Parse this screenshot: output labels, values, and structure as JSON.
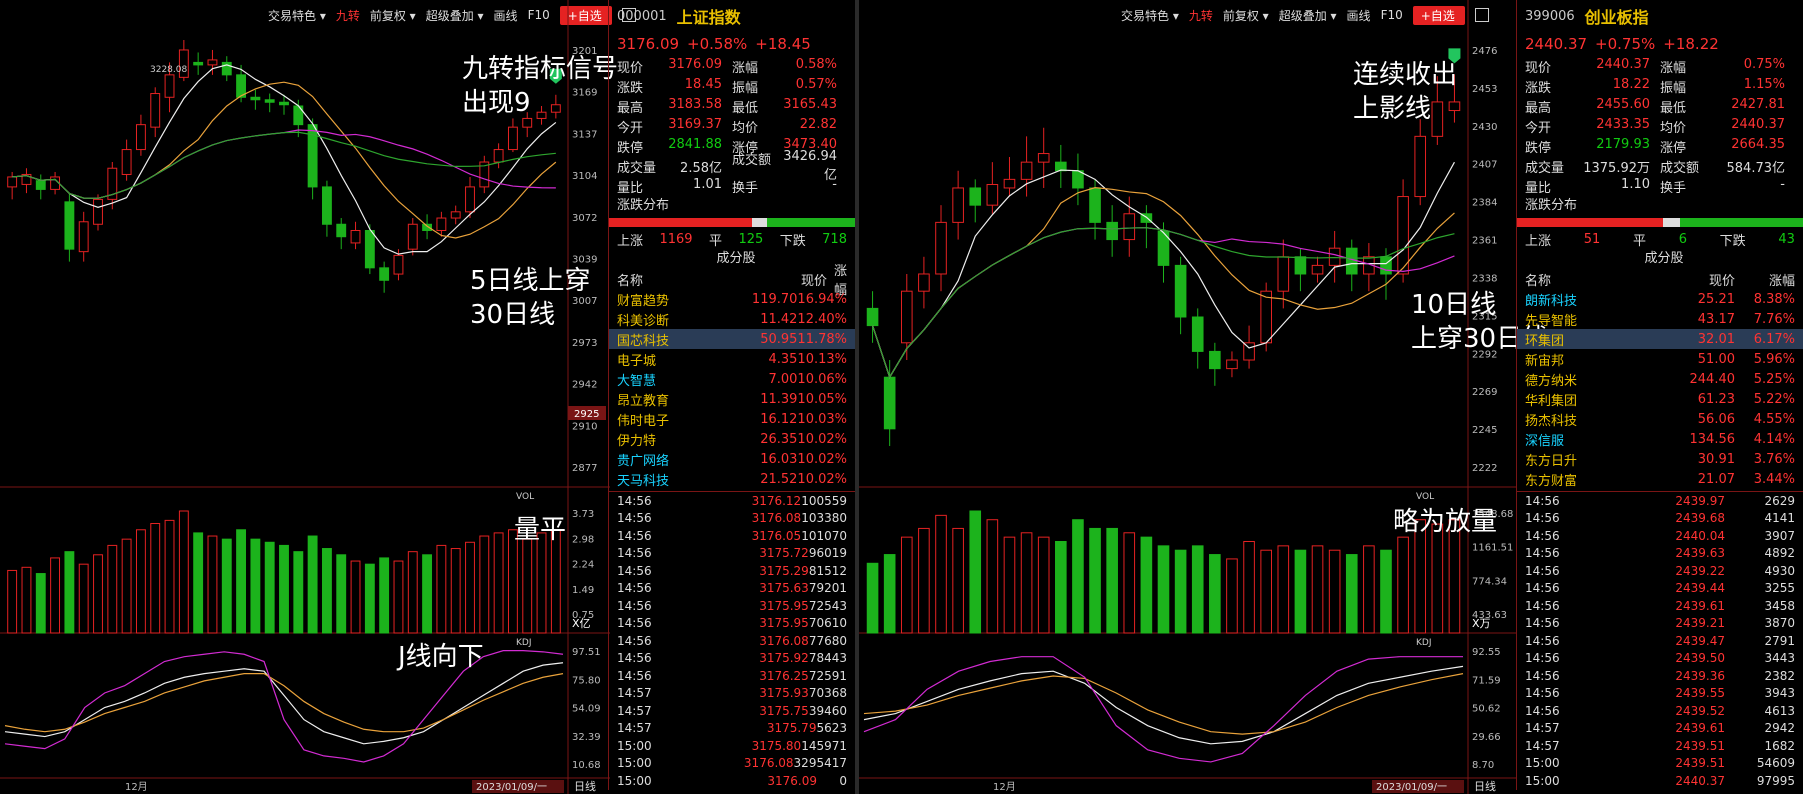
{
  "left": {
    "toolbar": [
      "交易特色 ▾",
      "九转",
      "前复权 ▾",
      "超级叠加 ▾",
      "画线",
      "F10",
      "+自选"
    ],
    "axis": [
      "3201",
      "3169",
      "3137",
      "3104",
      "3072",
      "3039",
      "3007",
      "2973",
      "2942",
      "2910",
      "2877"
    ],
    "price_tag": "2925",
    "high_label": "3228.08",
    "vol_label": "VOL",
    "vol_axis": [
      "3.73",
      "2.98",
      "2.24",
      "1.49",
      "0.75"
    ],
    "vol_unit": "X亿",
    "kdj_label": "KDJ",
    "kdj_axis": [
      "97.51",
      "75.80",
      "54.09",
      "32.39",
      "10.68"
    ],
    "month": "12月",
    "date": "2023/01/09/一",
    "period": "日线",
    "ann1": "九转指标信号\n出现9",
    "ann2": "5日线上穿\n30日线",
    "ann3": "量平",
    "ann4": "J线向下",
    "quote": {
      "code": "000001",
      "name": "上证指数",
      "price": "3176.09",
      "pct": "+0.58%",
      "chg": "+18.45",
      "rows": [
        [
          "现价",
          "3176.09",
          "涨幅",
          "0.58%"
        ],
        [
          "涨跌",
          "18.45",
          "振幅",
          "0.57%"
        ],
        [
          "最高",
          "3183.58",
          "最低",
          "3165.43"
        ],
        [
          "今开",
          "3169.37",
          "均价",
          "22.82"
        ],
        [
          "跌停",
          "2841.88",
          "涨停",
          "3473.40"
        ],
        [
          "成交量",
          "2.58亿",
          "成交额",
          "3426.94亿"
        ],
        [
          "量比",
          "1.01",
          "换手",
          "-"
        ]
      ],
      "dist_label": "涨跌分布",
      "up_label": "上涨",
      "up": "1169",
      "flat_label": "平",
      "flat": "125",
      "down_label": "下跌",
      "down": "718",
      "stock_title": "成分股",
      "stock_hdr": [
        "名称",
        "现价",
        "涨幅"
      ],
      "stocks": [
        [
          "财富趋势",
          "119.70",
          "16.94%"
        ],
        [
          "科美诊断",
          "11.42",
          "12.40%"
        ],
        [
          "国芯科技",
          "50.95",
          "11.78%"
        ],
        [
          "电子城",
          "4.35",
          "10.13%"
        ],
        [
          "大智慧",
          "7.00",
          "10.06%"
        ],
        [
          "昂立教育",
          "11.39",
          "10.05%"
        ],
        [
          "伟时电子",
          "16.12",
          "10.03%"
        ],
        [
          "伊力特",
          "26.35",
          "10.02%"
        ],
        [
          "贵广网络",
          "16.03",
          "10.02%"
        ],
        [
          "天马科技",
          "21.52",
          "10.02%"
        ]
      ],
      "ticks": [
        [
          "14:56",
          "3176.12",
          "100559"
        ],
        [
          "14:56",
          "3176.08",
          "103380"
        ],
        [
          "14:56",
          "3176.05",
          "101070"
        ],
        [
          "14:56",
          "3175.72",
          "96019"
        ],
        [
          "14:56",
          "3175.29",
          "81512"
        ],
        [
          "14:56",
          "3175.63",
          "79201"
        ],
        [
          "14:56",
          "3175.95",
          "72543"
        ],
        [
          "14:56",
          "3175.95",
          "70610"
        ],
        [
          "14:56",
          "3176.08",
          "77680"
        ],
        [
          "14:56",
          "3175.92",
          "78443"
        ],
        [
          "14:56",
          "3176.25",
          "72591"
        ],
        [
          "14:57",
          "3175.93",
          "70368"
        ],
        [
          "14:57",
          "3175.75",
          "39460"
        ],
        [
          "14:57",
          "3175.79",
          "5623"
        ],
        [
          "15:00",
          "3175.80",
          "145971"
        ],
        [
          "15:00",
          "3176.08",
          "3295417"
        ],
        [
          "15:00",
          "3176.09",
          "0"
        ]
      ]
    }
  },
  "right": {
    "toolbar": [
      "交易特色 ▾",
      "九转",
      "前复权 ▾",
      "超级叠加 ▾",
      "画线",
      "F10",
      "+自选"
    ],
    "axis": [
      "2476",
      "2453",
      "2430",
      "2407",
      "2384",
      "2361",
      "2338",
      "2315",
      "2292",
      "2269",
      "2245",
      "2222"
    ],
    "vol_axis": [
      "1548.68",
      "1161.51",
      "774.34",
      "433.63"
    ],
    "vol_unit": "X万",
    "vol_label": "VOL",
    "kdj_label": "KDJ",
    "kdj_axis": [
      "92.55",
      "71.59",
      "50.62",
      "29.66",
      "8.70"
    ],
    "month": "12月",
    "date": "2023/01/09/一",
    "period": "日线",
    "ann1": "连续收出\n上影线",
    "ann2": "10日线\n上穿30日线",
    "ann3": "略为放量",
    "quote": {
      "code": "399006",
      "name": "创业板指",
      "price": "2440.37",
      "pct": "+0.75%",
      "chg": "+18.22",
      "rows": [
        [
          "现价",
          "2440.37",
          "涨幅",
          "0.75%"
        ],
        [
          "涨跌",
          "18.22",
          "振幅",
          "1.15%"
        ],
        [
          "最高",
          "2455.60",
          "最低",
          "2427.81"
        ],
        [
          "今开",
          "2433.35",
          "均价",
          "2440.37"
        ],
        [
          "跌停",
          "2179.93",
          "涨停",
          "2664.35"
        ],
        [
          "成交量",
          "1375.92万",
          "成交额",
          "584.73亿"
        ],
        [
          "量比",
          "1.10",
          "换手",
          "-"
        ]
      ],
      "dist_label": "涨跌分布",
      "up_label": "上涨",
      "up": "51",
      "flat_label": "平",
      "flat": "6",
      "down_label": "下跌",
      "down": "43",
      "stock_title": "成分股",
      "stock_hdr": [
        "名称",
        "现价",
        "涨幅"
      ],
      "stocks": [
        [
          "朗新科技",
          "25.21",
          "8.38%"
        ],
        [
          "先导智能",
          "43.17",
          "7.76%"
        ],
        [
          "环集团",
          "32.01",
          "6.17%"
        ],
        [
          "新宙邦",
          "51.00",
          "5.96%"
        ],
        [
          "德方纳米",
          "244.40",
          "5.25%"
        ],
        [
          "华利集团",
          "61.23",
          "5.22%"
        ],
        [
          "扬杰科技",
          "56.06",
          "4.55%"
        ],
        [
          "深信服",
          "134.56",
          "4.14%"
        ],
        [
          "东方日升",
          "30.91",
          "3.76%"
        ],
        [
          "东方财富",
          "21.07",
          "3.44%"
        ]
      ],
      "ticks": [
        [
          "14:56",
          "2439.97",
          "2629"
        ],
        [
          "14:56",
          "2439.68",
          "4141"
        ],
        [
          "14:56",
          "2440.04",
          "3907"
        ],
        [
          "14:56",
          "2439.63",
          "4892"
        ],
        [
          "14:56",
          "2439.22",
          "4930"
        ],
        [
          "14:56",
          "2439.44",
          "3255"
        ],
        [
          "14:56",
          "2439.61",
          "3458"
        ],
        [
          "14:56",
          "2439.21",
          "3870"
        ],
        [
          "14:56",
          "2439.47",
          "2791"
        ],
        [
          "14:56",
          "2439.50",
          "3443"
        ],
        [
          "14:56",
          "2439.36",
          "2382"
        ],
        [
          "14:56",
          "2439.55",
          "3943"
        ],
        [
          "14:56",
          "2439.52",
          "4613"
        ],
        [
          "14:57",
          "2439.61",
          "2942"
        ],
        [
          "14:57",
          "2439.51",
          "1682"
        ],
        [
          "15:00",
          "2439.51",
          "54609"
        ],
        [
          "15:00",
          "2440.37",
          "97995"
        ]
      ]
    }
  },
  "chart_data": [
    {
      "type": "candlestick",
      "name": "上证指数",
      "ylim": [
        2877,
        3228
      ],
      "candles": [
        [
          3110,
          3118,
          3100,
          3122
        ],
        [
          3112,
          3120,
          3105,
          3125
        ],
        [
          3115,
          3108,
          3100,
          3120
        ],
        [
          3108,
          3118,
          3104,
          3122
        ],
        [
          3098,
          3060,
          3050,
          3105
        ],
        [
          3058,
          3082,
          3050,
          3090
        ],
        [
          3080,
          3100,
          3075,
          3104
        ],
        [
          3100,
          3125,
          3092,
          3130
        ],
        [
          3120,
          3140,
          3115,
          3148
        ],
        [
          3140,
          3160,
          3135,
          3168
        ],
        [
          3158,
          3185,
          3150,
          3190
        ],
        [
          3182,
          3200,
          3170,
          3210
        ],
        [
          3198,
          3220,
          3195,
          3228
        ],
        [
          3210,
          3208,
          3200,
          3218
        ],
        [
          3208,
          3212,
          3200,
          3220
        ],
        [
          3210,
          3200,
          3195,
          3215
        ],
        [
          3200,
          3182,
          3178,
          3208
        ],
        [
          3182,
          3180,
          3172,
          3188
        ],
        [
          3180,
          3178,
          3170,
          3185
        ],
        [
          3178,
          3176,
          3168,
          3184
        ],
        [
          3175,
          3160,
          3150,
          3180
        ],
        [
          3160,
          3110,
          3100,
          3165
        ],
        [
          3110,
          3080,
          3070,
          3115
        ],
        [
          3080,
          3070,
          3060,
          3085
        ],
        [
          3065,
          3075,
          3060,
          3082
        ],
        [
          3075,
          3045,
          3040,
          3080
        ],
        [
          3045,
          3035,
          3025,
          3050
        ],
        [
          3040,
          3055,
          3035,
          3060
        ],
        [
          3060,
          3080,
          3055,
          3085
        ],
        [
          3080,
          3075,
          3068,
          3088
        ],
        [
          3075,
          3085,
          3070,
          3090
        ],
        [
          3085,
          3090,
          3080,
          3095
        ],
        [
          3090,
          3110,
          3085,
          3118
        ],
        [
          3110,
          3130,
          3105,
          3135
        ],
        [
          3130,
          3140,
          3125,
          3145
        ],
        [
          3140,
          3158,
          3138,
          3165
        ],
        [
          3158,
          3165,
          3150,
          3170
        ],
        [
          3165,
          3170,
          3160,
          3175
        ],
        [
          3170,
          3176,
          3165,
          3184
        ]
      ],
      "volume": [
        2.0,
        2.1,
        1.9,
        2.4,
        2.6,
        2.2,
        2.5,
        2.8,
        3.0,
        3.3,
        3.5,
        3.6,
        3.9,
        3.2,
        3.1,
        3.0,
        3.3,
        3.0,
        2.9,
        2.8,
        2.6,
        3.1,
        2.7,
        2.5,
        2.3,
        2.2,
        2.4,
        2.3,
        2.6,
        2.5,
        2.8,
        2.7,
        2.9,
        3.1,
        3.2,
        3.3,
        3.0,
        3.2,
        3.3
      ],
      "ninex": [
        3169
      ],
      "kdj": {
        "K": [
          30,
          28,
          26,
          30,
          40,
          50,
          55,
          62,
          70,
          75,
          78,
          80,
          82,
          80,
          60,
          40,
          30,
          25,
          20,
          22,
          25,
          30,
          40,
          50,
          60,
          70,
          80,
          85,
          87
        ],
        "D": [
          35,
          32,
          30,
          32,
          38,
          45,
          50,
          55,
          62,
          67,
          72,
          75,
          78,
          78,
          68,
          55,
          45,
          38,
          32,
          30,
          30,
          33,
          40,
          48,
          56,
          63,
          70,
          75,
          78
        ],
        "J": [
          20,
          18,
          16,
          24,
          50,
          62,
          68,
          78,
          88,
          92,
          94,
          96,
          94,
          88,
          40,
          15,
          10,
          8,
          5,
          10,
          20,
          40,
          60,
          80,
          92,
          97,
          97,
          96,
          94
        ]
      }
    },
    {
      "type": "candlestick",
      "name": "创业板指",
      "ylim": [
        2222,
        2476
      ],
      "candles": [
        [
          2320,
          2310,
          2300,
          2330
        ],
        [
          2280,
          2250,
          2240,
          2290
        ],
        [
          2300,
          2330,
          2290,
          2340
        ],
        [
          2330,
          2340,
          2320,
          2350
        ],
        [
          2340,
          2370,
          2330,
          2380
        ],
        [
          2370,
          2390,
          2360,
          2400
        ],
        [
          2390,
          2380,
          2370,
          2395
        ],
        [
          2380,
          2392,
          2375,
          2405
        ],
        [
          2390,
          2395,
          2385,
          2408
        ],
        [
          2395,
          2405,
          2385,
          2420
        ],
        [
          2405,
          2410,
          2390,
          2425
        ],
        [
          2405,
          2400,
          2390,
          2415
        ],
        [
          2400,
          2390,
          2380,
          2410
        ],
        [
          2390,
          2370,
          2360,
          2395
        ],
        [
          2370,
          2360,
          2350,
          2380
        ],
        [
          2360,
          2375,
          2350,
          2385
        ],
        [
          2375,
          2370,
          2355,
          2380
        ],
        [
          2365,
          2345,
          2335,
          2370
        ],
        [
          2345,
          2315,
          2305,
          2350
        ],
        [
          2315,
          2295,
          2285,
          2320
        ],
        [
          2295,
          2285,
          2275,
          2300
        ],
        [
          2285,
          2290,
          2280,
          2295
        ],
        [
          2290,
          2300,
          2285,
          2310
        ],
        [
          2300,
          2330,
          2295,
          2335
        ],
        [
          2330,
          2350,
          2320,
          2360
        ],
        [
          2350,
          2340,
          2330,
          2355
        ],
        [
          2340,
          2345,
          2335,
          2350
        ],
        [
          2345,
          2355,
          2335,
          2365
        ],
        [
          2355,
          2340,
          2330,
          2360
        ],
        [
          2340,
          2350,
          2330,
          2358
        ],
        [
          2350,
          2340,
          2325,
          2355
        ],
        [
          2340,
          2385,
          2335,
          2395
        ],
        [
          2385,
          2420,
          2380,
          2430
        ],
        [
          2420,
          2440,
          2415,
          2455
        ],
        [
          2435,
          2440,
          2428,
          2456
        ]
      ],
      "volume": [
        800,
        900,
        1100,
        1200,
        1350,
        1200,
        1400,
        1300,
        1100,
        1150,
        1100,
        1050,
        1300,
        1200,
        1200,
        1150,
        1100,
        1000,
        950,
        1000,
        900,
        850,
        1050,
        950,
        1000,
        950,
        1000,
        950,
        900,
        1000,
        950,
        1100,
        1300,
        1250,
        1300
      ],
      "ninex": [
        2430
      ],
      "kdj": {
        "K": [
          40,
          45,
          55,
          65,
          72,
          78,
          80,
          70,
          50,
          35,
          25,
          20,
          22,
          30,
          45,
          60,
          70,
          75,
          80,
          84
        ],
        "D": [
          45,
          47,
          52,
          60,
          66,
          72,
          76,
          74,
          62,
          48,
          38,
          30,
          28,
          30,
          38,
          50,
          60,
          67,
          73,
          78
        ],
        "J": [
          30,
          40,
          65,
          80,
          88,
          92,
          92,
          75,
          35,
          15,
          8,
          5,
          12,
          35,
          60,
          80,
          90,
          92,
          92,
          92
        ]
      }
    }
  ]
}
